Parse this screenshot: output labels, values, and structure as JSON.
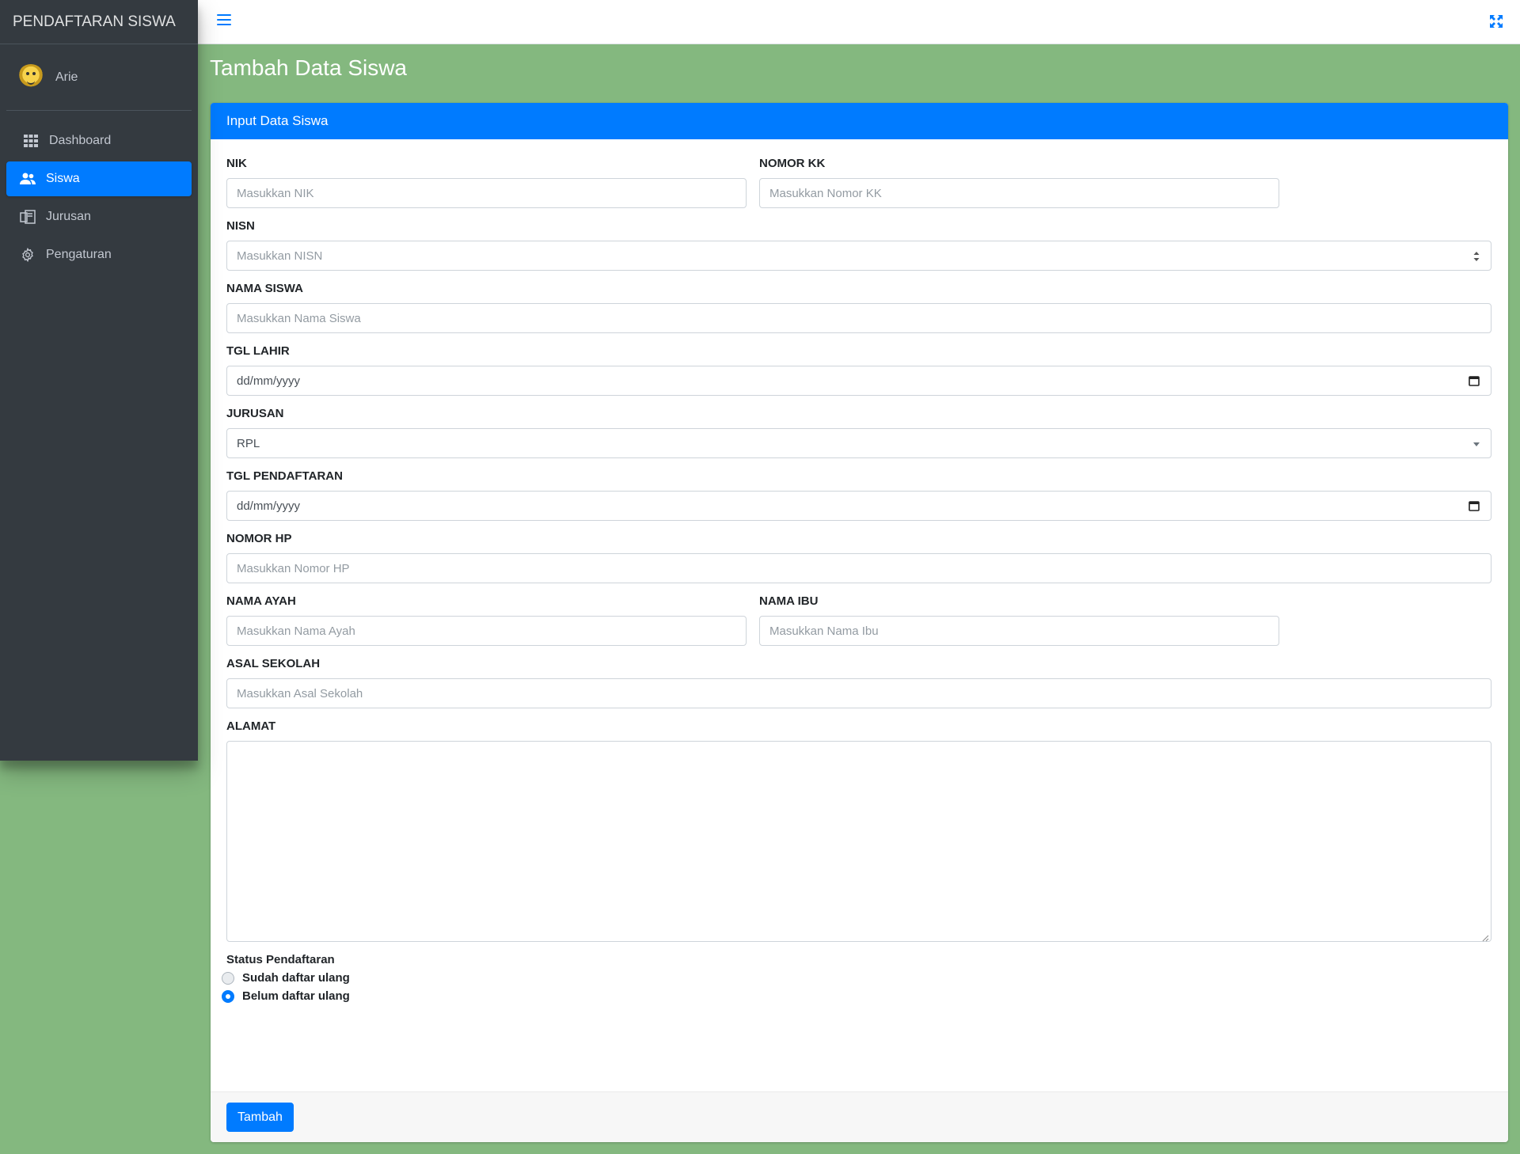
{
  "app": {
    "brand": "PENDAFTARAN SISWA",
    "user_name": "Arie"
  },
  "sidebar": {
    "items": [
      {
        "label": "Dashboard",
        "icon": "grid-icon",
        "active": false
      },
      {
        "label": "Siswa",
        "icon": "users-icon",
        "active": true
      },
      {
        "label": "Jurusan",
        "icon": "book-icon",
        "active": false
      },
      {
        "label": "Pengaturan",
        "icon": "gear-icon",
        "active": false
      }
    ]
  },
  "header": {
    "menu_icon": "hamburger-icon",
    "fullscreen_icon": "expand-icon"
  },
  "page": {
    "title": "Tambah Data Siswa"
  },
  "form": {
    "card_title": "Input Data Siswa",
    "nik": {
      "label": "NIK",
      "placeholder": "Masukkan NIK"
    },
    "nomor_kk": {
      "label": "NOMOR KK",
      "placeholder": "Masukkan Nomor KK"
    },
    "nisn": {
      "label": "NISN",
      "placeholder": "Masukkan NISN"
    },
    "nama_siswa": {
      "label": "NAMA SISWA",
      "placeholder": "Masukkan Nama Siswa"
    },
    "tgl_lahir": {
      "label": "TGL LAHIR",
      "value": "dd/mm/yyyy"
    },
    "jurusan": {
      "label": "JURUSAN",
      "value": "RPL"
    },
    "tgl_pendaftaran": {
      "label": "TGL PENDAFTARAN",
      "value": "dd/mm/yyyy"
    },
    "nomor_hp": {
      "label": "NOMOR HP",
      "placeholder": "Masukkan Nomor HP"
    },
    "nama_ayah": {
      "label": "NAMA AYAH",
      "placeholder": "Masukkan Nama Ayah"
    },
    "nama_ibu": {
      "label": "NAMA IBU",
      "placeholder": "Masukkan Nama Ibu"
    },
    "asal_sekolah": {
      "label": "ASAL SEKOLAH",
      "placeholder": "Masukkan Asal Sekolah"
    },
    "alamat": {
      "label": "ALAMAT"
    },
    "status": {
      "label": "Status Pendaftaran",
      "options": [
        {
          "label": "Sudah daftar ulang",
          "checked": false
        },
        {
          "label": "Belum daftar ulang",
          "checked": true
        }
      ]
    },
    "submit_label": "Tambah"
  },
  "colors": {
    "background": "#84b87f",
    "sidebar": "#343a40",
    "primary": "#007bff"
  }
}
